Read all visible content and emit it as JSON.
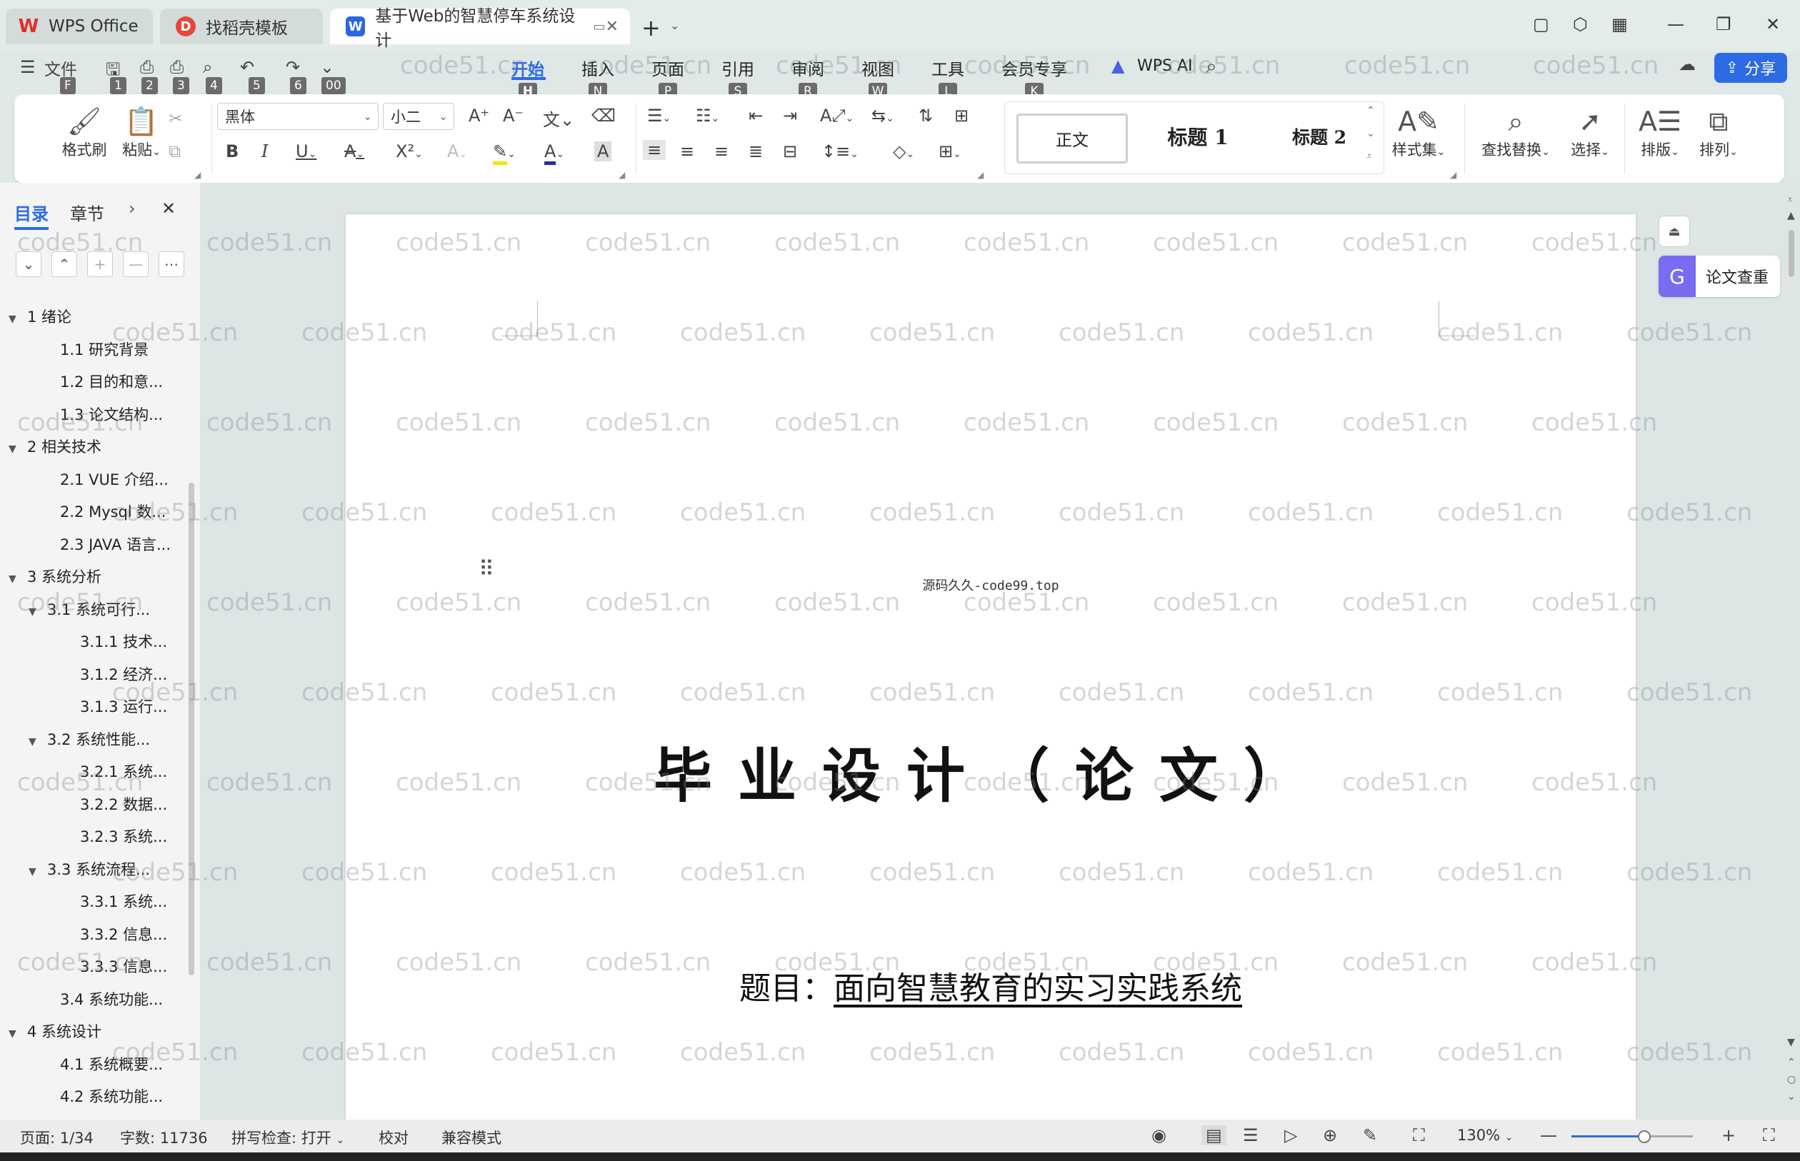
{
  "tabs": [
    {
      "label": "WPS Office",
      "icon": "wps-logo-icon"
    },
    {
      "label": "找稻壳模板",
      "icon": "daoke-icon"
    },
    {
      "label": "基于Web的智慧停车系统设计",
      "icon": "word-doc-icon"
    }
  ],
  "menu": {
    "file": "文件",
    "file_key": "F",
    "quick_keys": [
      "1",
      "2",
      "3",
      "4",
      "5",
      "6",
      "00"
    ],
    "tabs": [
      {
        "label": "开始",
        "key": "H"
      },
      {
        "label": "插入",
        "key": "N"
      },
      {
        "label": "页面",
        "key": "P"
      },
      {
        "label": "引用",
        "key": "S"
      },
      {
        "label": "审阅",
        "key": "R"
      },
      {
        "label": "视图",
        "key": "W"
      },
      {
        "label": "工具",
        "key": "L"
      },
      {
        "label": "会员专享",
        "key": "K"
      }
    ],
    "wps_ai": "WPS AI",
    "share": "分享"
  },
  "ribbon": {
    "format_painter": "格式刷",
    "paste": "粘贴",
    "font_name": "黑体",
    "font_size": "小二",
    "styles": {
      "normal": "正文",
      "h1": "标题 1",
      "h2": "标题 2"
    },
    "style_set": "样式集",
    "find_replace": "查找替换",
    "select": "选择",
    "layout": "排版",
    "arrange": "排列"
  },
  "nav": {
    "tab_toc": "目录",
    "tab_chapters": "章节",
    "items": [
      {
        "level": 1,
        "text": "1 绪论",
        "arrow": "▼"
      },
      {
        "level": 2,
        "text": "1.1 研究背景"
      },
      {
        "level": 2,
        "text": "1.2 目的和意..."
      },
      {
        "level": 2,
        "text": "1.3 论文结构..."
      },
      {
        "level": 1,
        "text": "2 相关技术",
        "arrow": "▼"
      },
      {
        "level": 2,
        "text": "2.1 VUE 介绍..."
      },
      {
        "level": 2,
        "text": "2.2 Mysql 数..."
      },
      {
        "level": 2,
        "text": "2.3 JAVA 语言..."
      },
      {
        "level": 1,
        "text": "3 系统分析",
        "arrow": "▼"
      },
      {
        "level": 2,
        "text": "3.1 系统可行...",
        "arrow": "▼"
      },
      {
        "level": 3,
        "text": "3.1.1 技术..."
      },
      {
        "level": 3,
        "text": "3.1.2 经济..."
      },
      {
        "level": 3,
        "text": "3.1.3 运行..."
      },
      {
        "level": 2,
        "text": "3.2 系统性能...",
        "arrow": "▼"
      },
      {
        "level": 3,
        "text": "3.2.1 系统..."
      },
      {
        "level": 3,
        "text": "3.2.2 数据..."
      },
      {
        "level": 3,
        "text": "3.2.3 系统..."
      },
      {
        "level": 2,
        "text": "3.3 系统流程...",
        "arrow": "▼"
      },
      {
        "level": 3,
        "text": "3.3.1 系统..."
      },
      {
        "level": 3,
        "text": "3.3.2 信息..."
      },
      {
        "level": 3,
        "text": "3.3.3 信息..."
      },
      {
        "level": 2,
        "text": "3.4 系统功能..."
      },
      {
        "level": 1,
        "text": "4 系统设计",
        "arrow": "▼"
      },
      {
        "level": 2,
        "text": "4.1 系统概要..."
      },
      {
        "level": 2,
        "text": "4.2 系统功能..."
      }
    ]
  },
  "document": {
    "source_line": "源码久久-code99.top",
    "title": "毕业设计（论文）",
    "subject_label": "题目：",
    "subject_value": "面向智慧教育的实习实践系统"
  },
  "side": {
    "paper_check": "论文查重"
  },
  "status": {
    "page": "页面: 1/34",
    "words": "字数: 11736",
    "spell": "拼写检查: 打开",
    "proof": "校对",
    "compat": "兼容模式",
    "zoom": "130%",
    "zoom_fraction": 0.59
  },
  "watermark": "code51.cn",
  "colors": {
    "accent": "#2d6be4",
    "wps_red": "#e0302a",
    "paper_check": "#7a6cf0"
  }
}
